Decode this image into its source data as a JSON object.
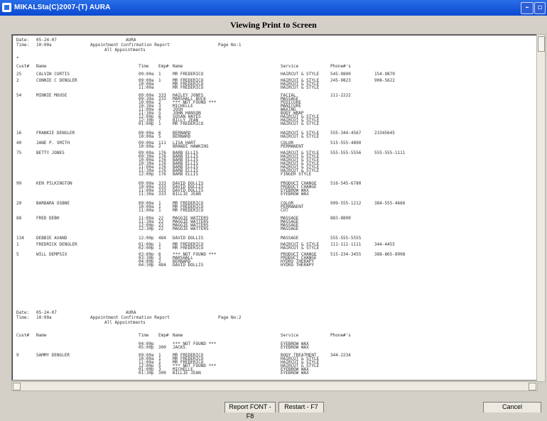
{
  "window": {
    "title": "MIKALSta(C)2007-(T) AURA",
    "minimize_symbol": "–",
    "maximize_symbol": "▫ ×"
  },
  "header": {
    "title": "Viewing Print to Screen"
  },
  "report": {
    "page1": {
      "date_label": "Date:",
      "date": "05-24-07",
      "time_label": "Time:",
      "time": "10:00a",
      "company": "AURA",
      "report_title": "Appointment Confirmation Report",
      "subtitle": "All Appointments",
      "page_label": "Page No:1",
      "col_cust": "Cust#",
      "col_name": "Name",
      "col_time": "Time",
      "col_emp": "Emp#",
      "col_emp_name": "Name",
      "col_service": "Service",
      "col_phones": "Phone#'s"
    },
    "customers": [
      {
        "id": "25",
        "name": "CALVIN CURTIS",
        "times": [
          "09:00a"
        ],
        "emps": [
          "1"
        ],
        "emp_names": [
          "MR FREDERICO"
        ],
        "services": [
          "HAIRCUT & STYLE"
        ],
        "phone1": "545-9800",
        "phone2": "154-9870"
      },
      {
        "id": "2",
        "name": "CONNIE C DENGLER",
        "times": [
          "09:00a",
          "10:00a",
          "11:00a"
        ],
        "emps": [
          "1",
          "",
          ""
        ],
        "emp_names": [
          "MR FREDERICO",
          "MR FREDERICO",
          "MR FREDERICO"
        ],
        "services": [
          "HAIRCUT & STYLE",
          "HAIRCUT & STYLE",
          "HAIRCUT & STYLE"
        ],
        "phone1": "245-9823",
        "phone2": "908-5622"
      },
      {
        "id": "54",
        "name": "MINNIE MOUSE",
        "times": [
          "09:00a",
          "09:30a",
          "10:00a",
          "10:30a",
          "11:00a",
          "11:30a",
          "12:00p",
          "12:30p",
          "01:00p"
        ],
        "emps": [
          "333",
          "333",
          "2",
          "3",
          "4",
          "5",
          "6",
          "7",
          "1"
        ],
        "emp_names": [
          "HAILEY JONES",
          "MARSHALL BUCK",
          "*** NOT FOUND ***",
          "MICHELLE",
          "JOSH",
          "JOHN HANSON",
          "SUSAN HAYES",
          "BILLY JEAN",
          "MR FREDERICO"
        ],
        "services": [
          "FACIAL",
          "MASSAGE",
          "PEDICURE",
          "MANICURE",
          "WAXING",
          "BODY WRAP",
          "HAIRCUT & STYLE",
          "HAIRCUT & STYLE",
          "HAIRCUT & STYLE"
        ],
        "phone1": "111-2222",
        "phone2": ""
      },
      {
        "id": "16",
        "name": "FRANKIE DENGLER",
        "times": [
          "09:00a",
          "10:00a"
        ],
        "emps": [
          "6",
          "5"
        ],
        "emp_names": [
          "BERNARD",
          "BERNARD"
        ],
        "services": [
          "HAIRCUT & STYLE",
          "HAIRCUT & STYLE"
        ],
        "phone1": "555-344-4567",
        "phone2": "23345645"
      },
      {
        "id": "40",
        "name": "JANE P. SMITH",
        "times": [
          "09:00a",
          "10:00a"
        ],
        "emps": [
          "111",
          "2"
        ],
        "emp_names": [
          "LISA HART",
          "BRANDI HAWKINS"
        ],
        "services": [
          "COLOR",
          "PERMANENT"
        ],
        "phone1": "515-555-4890",
        "phone2": ""
      },
      {
        "id": "75",
        "name": "BETTY JONES",
        "times": [
          "09:00a",
          "09:30a",
          "10:00a",
          "10:30a",
          "11:00a",
          "11:30a",
          "12:00p"
        ],
        "emps": [
          "176",
          "176",
          "176",
          "176",
          "176",
          "176",
          "176"
        ],
        "emp_names": [
          "BARB ELLIS",
          "BARB ELLIS",
          "BARB ELLIS",
          "BARB ELLIS",
          "BARB ELLIS",
          "BARB ELLIS",
          "BARB ELLIS"
        ],
        "services": [
          "HAIRCUT & STYLE",
          "HAIRCUT & STYLE",
          "HAIRCUT & STYLE",
          "HAIRCUT & STYLE",
          "HAIRCUT & STYLE",
          "HAIRCUT & STYLE",
          "FINGER STYLE"
        ],
        "phone1": "555-555-5556",
        "phone2": "555-555-1111"
      },
      {
        "id": "99",
        "name": "KEN PILKINGTON",
        "times": [
          "09:00a",
          "10:00a",
          "11:00a",
          "11:30a"
        ],
        "emps": [
          "333",
          "333",
          "333",
          "333"
        ],
        "emp_names": [
          "DAVID DOLLIS",
          "DAVID DOLLIS",
          "DAVID DOLLIS",
          "BILLIE JEAN"
        ],
        "services": [
          "PRODUCT CHANGE",
          "PRODUCT CHANGE",
          "EYEBROW WAX",
          "EYEBROW WAX"
        ],
        "phone1": "516-545-6780",
        "phone2": ""
      },
      {
        "id": "20",
        "name": "BARBARA OSBNE",
        "times": [
          "09:00a",
          "10:00a",
          "11:00a"
        ],
        "emps": [
          "1",
          "1",
          "1"
        ],
        "emp_names": [
          "MR FREDERICO",
          "MR FREDERICO",
          "MR FREDERICO"
        ],
        "services": [
          "COLOR",
          "PERMANENT",
          "CUT"
        ],
        "phone1": "999-555-1212",
        "phone2": "384-555-4666"
      },
      {
        "id": "88",
        "name": "FRED DEBH",
        "times": [
          "11:00a",
          "11:30a",
          "12:00p",
          "12:30p"
        ],
        "emps": [
          "22",
          "22",
          "22",
          "22"
        ],
        "emp_names": [
          "MAGGIE WATTERS",
          "MAGGIE WATTERS",
          "MAGGIE WATTERS",
          "MAGGIE WATTERS"
        ],
        "services": [
          "MASSAGE",
          "MASSAGE",
          "MASSAGE",
          "MASSAGE"
        ],
        "phone1": "883-8890",
        "phone2": ""
      },
      {
        "id": "134",
        "name": "DEBBIE AVAND",
        "times": [
          "12:00p"
        ],
        "emps": [
          "484"
        ],
        "emp_names": [
          "DAVID DOLLIS"
        ],
        "services": [
          "MASSAGE"
        ],
        "phone1": "555-555-5555",
        "phone2": ""
      },
      {
        "id": "1",
        "name": "FREDRICK DENGLER",
        "times": [
          "01:00p",
          "02:00p"
        ],
        "emps": [
          "1",
          "1"
        ],
        "emp_names": [
          "MR FREDERICO",
          "MR FREDERICO"
        ],
        "services": [
          "HAIRCUT & STYLE",
          "HAIRCUT & STYLE"
        ],
        "phone1": "111-111-1111",
        "phone2": "344-4455"
      },
      {
        "id": "5",
        "name": "WILL DEMPSIX",
        "times": [
          "03:00p",
          "03:30p",
          "04:00p",
          "04:30p"
        ],
        "emps": [
          "6",
          "3",
          "2",
          "484"
        ],
        "emp_names": [
          "*** NOT FOUND ***",
          "MARSHALL",
          "BERNARD",
          "DAVID DOLLIS"
        ],
        "services": [
          "PRODUCT CHANGE",
          "PRODUCT CHANGE",
          "HYDRO THERAPY",
          "HYDRO THERAPY"
        ],
        "phone1": "515-234-3455",
        "phone2": "388-865-8908"
      }
    ],
    "page2": {
      "date_label": "Date:",
      "date": "05-24-07",
      "time_label": "Time:",
      "time": "10:00a",
      "company": "AURA",
      "report_title": "Appointment Confirmation Report",
      "subtitle": "All Appointments",
      "page_label": "Page No:2",
      "col_cust": "Cust#",
      "col_name": "Name",
      "col_time": "Time",
      "col_emp": "Emp#",
      "col_emp_name": "Name",
      "col_service": "Service",
      "col_phones": "Phone#'s"
    },
    "page2_customers": [
      {
        "id": "",
        "name": "",
        "times": [
          "04:00p",
          "05:00p"
        ],
        "emps": [
          "",
          "300"
        ],
        "emp_names": [
          "*** NOT FOUND ***",
          "JACKS"
        ],
        "services": [
          "EYEBROW WAX",
          "EYEBROW WAX"
        ],
        "phone1": "",
        "phone2": ""
      },
      {
        "id": "9",
        "name": "SAMMY DENGLER",
        "times": [
          "09:00a",
          "10:00a",
          "11:00a",
          "12:00p",
          "01:00p",
          "01:30p"
        ],
        "emps": [
          "1",
          "1",
          "1",
          "5",
          "3",
          "300"
        ],
        "emp_names": [
          "MR FREDERICO",
          "MR FREDERICO",
          "MR FREDERICO",
          "*** NOT FOUND ***",
          "MICHELLE",
          "BILLIE JEAN"
        ],
        "services": [
          "BODY TREATMENT",
          "HAIRCUT & STYLE",
          "HAIRCUT & STYLE",
          "HAIRCUT & STYLE",
          "EYEBROW WAX",
          "EYEBROW WAX"
        ],
        "phone1": "344-2234",
        "phone2": ""
      }
    ]
  },
  "buttons": {
    "font": "Report FONT - F8",
    "print": "Restart - F7",
    "cancel": "Cancel"
  }
}
